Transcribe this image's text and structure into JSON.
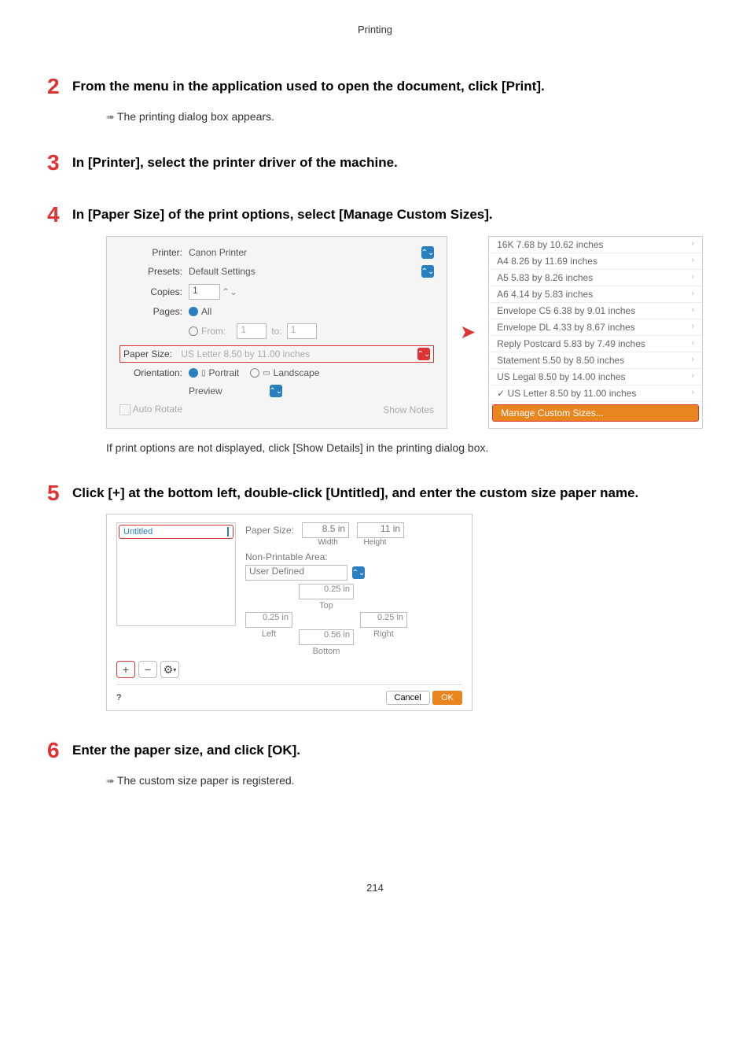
{
  "header": "Printing",
  "steps": [
    {
      "num": "2",
      "title": "From the menu in the application used to open the document, click [Print].",
      "sub": "The printing dialog box appears."
    },
    {
      "num": "3",
      "title": "In [Printer], select the printer driver of the machine."
    },
    {
      "num": "4",
      "title": "In [Paper Size] of the print options, select [Manage Custom Sizes].",
      "note": "If print options are not displayed, click [Show Details] in the printing dialog box."
    },
    {
      "num": "5",
      "title": "Click [+] at the bottom left, double-click [Untitled], and enter the custom size paper name."
    },
    {
      "num": "6",
      "title": "Enter the paper size, and click [OK].",
      "sub": "The custom size paper is registered."
    }
  ],
  "print_dialog": {
    "printer_label": "Printer:",
    "printer_value": "Canon Printer",
    "presets_label": "Presets:",
    "presets_value": "Default Settings",
    "copies_label": "Copies:",
    "copies_value": "1",
    "pages_label": "Pages:",
    "all": "All",
    "from_label": "From:",
    "from_value": "1",
    "to_label": "to:",
    "to_value": "1",
    "paper_size_label": "Paper Size:",
    "paper_size_value": "US Letter 8.50 by 11.00 inches",
    "orientation_label": "Orientation:",
    "portrait": "Portrait",
    "landscape": "Landscape",
    "preview": "Preview",
    "auto_rotate": "Auto Rotate",
    "show_notes": "Show Notes"
  },
  "size_menu": {
    "items": [
      "16K 7.68 by 10.62 inches",
      "A4 8.26 by 11.69 inches",
      "A5 5.83 by 8.26 inches",
      "A6 4.14 by 5.83 inches",
      "Envelope C5 6.38 by 9.01 inches",
      "Envelope DL 4.33 by 8.67 inches",
      "Reply Postcard 5.83 by 7.49 inches",
      "Statement 5.50 by 8.50 inches",
      "US Legal 8.50 by 14.00 inches",
      "✓ US Letter 8.50 by 11.00 inches"
    ],
    "manage": "Manage Custom Sizes..."
  },
  "custom_dialog": {
    "item": "Untitled",
    "paper_size_label": "Paper Size:",
    "width_val": "8.5 in",
    "height_val": "11 in",
    "width_lbl": "Width",
    "height_lbl": "Height",
    "npa": "Non-Printable Area:",
    "ud": "User Defined",
    "top": "0.25 in",
    "top_lbl": "Top",
    "left": "0.25 in",
    "left_lbl": "Left",
    "right": "0.25 in",
    "right_lbl": "Right",
    "bottom": "0.56 in",
    "bottom_lbl": "Bottom",
    "q": "?",
    "cancel": "Cancel",
    "ok": "OK"
  },
  "page_number": "214"
}
